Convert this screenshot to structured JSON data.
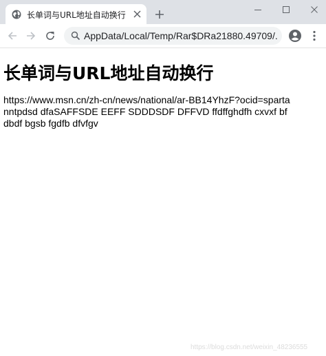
{
  "tab": {
    "title": "长单词与URL地址自动换行"
  },
  "toolbar": {
    "url": "AppData/Local/Temp/Rar$DRa21880.49709/..."
  },
  "page": {
    "heading": "长单词与URL地址自动换行",
    "paragraph": "https://www.msn.cn/zh-cn/news/national/ar-BB14YhzF?ocid=spartanntpdsd dfaSAFFSDE EEFF SDDDSDF DFFVD ffdffghdfh cxvxf bfdbdf bgsb fgdfb dfvfgv"
  },
  "watermark": "https://blog.csdn.net/weixin_48236555",
  "icons": {
    "favicon": "globe-icon",
    "close": "close-icon",
    "new_tab": "plus-icon",
    "back": "arrow-left-icon",
    "forward": "arrow-right-icon",
    "reload": "reload-icon",
    "search": "search-icon",
    "profile": "account-circle-icon",
    "menu": "more-vertical-icon"
  },
  "colors": {
    "titlebar": "#dee1e6",
    "omnibox": "#f1f3f4",
    "icon": "#5f6368"
  }
}
